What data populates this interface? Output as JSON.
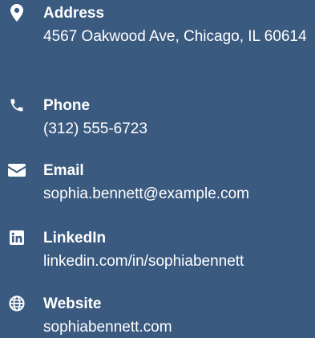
{
  "theme": {
    "background": "#3b5a80",
    "text": "#ffffff"
  },
  "contacts": [
    {
      "icon": "map-marker-icon",
      "label": "Address",
      "value": "4567 Oakwood Ave, Chicago, IL 60614"
    },
    {
      "icon": "phone-icon",
      "label": "Phone",
      "value": "(312) 555-6723"
    },
    {
      "icon": "envelope-icon",
      "label": "Email",
      "value": "sophia.bennett@example.com"
    },
    {
      "icon": "linkedin-icon",
      "label": "LinkedIn",
      "value": "linkedin.com/in/sophiabennett"
    },
    {
      "icon": "globe-icon",
      "label": "Website",
      "value": "sophiabennett.com"
    }
  ]
}
